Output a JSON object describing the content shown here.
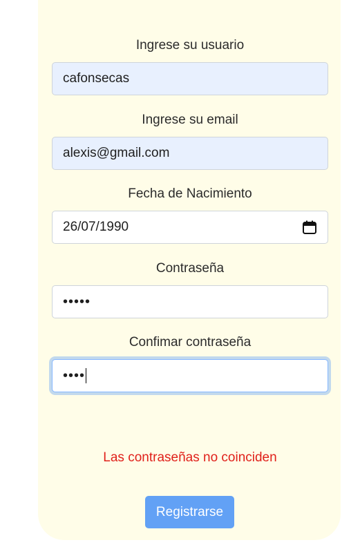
{
  "form": {
    "username": {
      "label": "Ingrese su usuario",
      "value": "cafonsecas"
    },
    "email": {
      "label": "Ingrese su email",
      "value": "alexis@gmail.com"
    },
    "birthdate": {
      "label": "Fecha de Nacimiento",
      "value": "26/07/1990",
      "icon": "calendar-icon"
    },
    "password": {
      "label": "Contraseña",
      "value": "•••••"
    },
    "confirm_password": {
      "label": "Confimar contraseña",
      "value": "••••"
    },
    "error_message": "Las contraseñas no coinciden",
    "submit_label": "Registrarse"
  },
  "colors": {
    "card_background": "#fffde8",
    "autofill_background": "#e8f0fe",
    "error": "#e0201a",
    "button": "#62a1f5"
  }
}
